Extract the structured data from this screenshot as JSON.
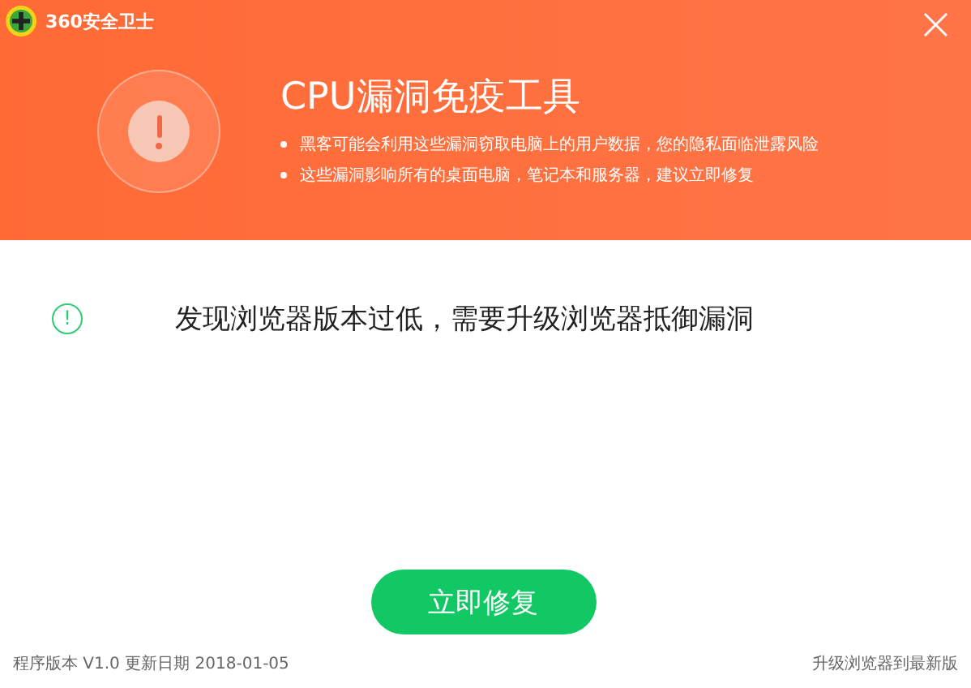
{
  "window": {
    "title": "360安全卫士",
    "close": "×"
  },
  "header": {
    "title": "CPU漏洞免疫工具",
    "bullets": [
      "黑客可能会利用这些漏洞窃取电脑上的用户数据，您的隐私面临泄露风险",
      "这些漏洞影响所有的桌面电脑，笔记本和服务器，建议立即修复"
    ]
  },
  "message": {
    "kind": "warning",
    "icon": "!",
    "text": "发现浏览器版本过低，需要升级浏览器抵御漏洞"
  },
  "primary_button": "立即修复",
  "footer": {
    "version_info": "程序版本 V1.0 更新日期 2018-01-05",
    "link": "升级浏览器到最新版"
  }
}
